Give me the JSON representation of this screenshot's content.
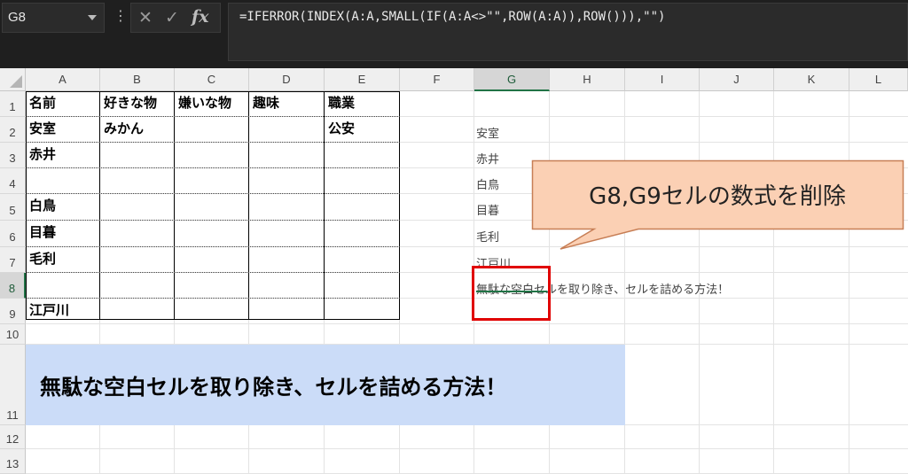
{
  "name_box": {
    "value": "G8"
  },
  "formula_bar": {
    "formula": "=IFERROR(INDEX(A:A,SMALL(IF(A:A<>\"\",ROW(A:A)),ROW())),\"\")",
    "cancel_symbol": "✕",
    "enter_symbol": "✓",
    "fx_label": "fx",
    "dots": "⋮"
  },
  "columns": [
    "A",
    "B",
    "C",
    "D",
    "E",
    "F",
    "G",
    "H",
    "I",
    "J",
    "K",
    "L"
  ],
  "rows": [
    "1",
    "2",
    "3",
    "4",
    "5",
    "6",
    "7",
    "8",
    "9",
    "10",
    "11",
    "12",
    "13"
  ],
  "selected_cell": {
    "column": "G",
    "row": "8"
  },
  "table": {
    "headers": [
      "名前",
      "好きな物",
      "嫌いな物",
      "趣味",
      "職業"
    ],
    "rows": [
      [
        "安室",
        "みかん",
        "",
        "",
        "公安"
      ],
      [
        "赤井",
        "",
        "",
        "",
        ""
      ],
      [
        "",
        "",
        "",
        "",
        ""
      ],
      [
        "白鳥",
        "",
        "",
        "",
        ""
      ],
      [
        "目暮",
        "",
        "",
        "",
        ""
      ],
      [
        "毛利",
        "",
        "",
        "",
        ""
      ],
      [
        "",
        "",
        "",
        "",
        ""
      ],
      [
        "江戸川",
        "",
        "",
        "",
        ""
      ]
    ]
  },
  "column_g_values": [
    "安室",
    "赤井",
    "白鳥",
    "目暮",
    "毛利",
    "江戸川",
    "無駄な空白セルを取り除き、セルを詰める方法！"
  ],
  "banner": {
    "text": "無駄な空白セルを取り除き、セルを詰める方法！"
  },
  "callout": {
    "text": "G8,G9セルの数式を削除"
  },
  "colors": {
    "callout_fill": "#fbd0b4",
    "callout_border": "#c77e55",
    "highlight_border": "#e00000",
    "banner_fill": "#cbdcf8",
    "accent": "#217346"
  }
}
